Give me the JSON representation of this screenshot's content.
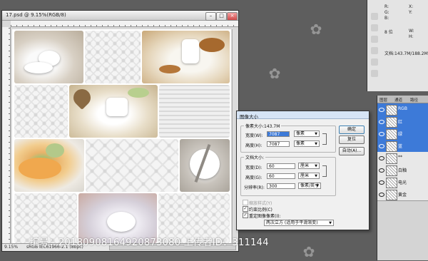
{
  "document": {
    "title": "17.psd @ 9.15%(RGB/8)",
    "zoom": "9.15%",
    "color_profile": "sRGB IEC61966-2.1 (8bpc)"
  },
  "info_panel": {
    "r": "R:",
    "g": "G:",
    "b": "B:",
    "bits": "8 位",
    "x": "X:",
    "y": "Y:",
    "w": "W:",
    "h": "H:",
    "doc": "文档:143.7M/188.2M"
  },
  "layers_panel": {
    "tabs": [
      "图层",
      "通道",
      "路径"
    ],
    "layers": [
      {
        "name": "RGB",
        "selected": true
      },
      {
        "name": "红",
        "selected": true
      },
      {
        "name": "绿",
        "selected": true
      },
      {
        "name": "蓝",
        "selected": true
      },
      {
        "name": "**",
        "selected": false
      },
      {
        "name": "白釉",
        "selected": false
      },
      {
        "name": "电光",
        "selected": false
      },
      {
        "name": "黄金",
        "selected": false
      }
    ]
  },
  "dialog": {
    "title": "图像大小",
    "pixel_dim_label": "像素大小:143.7M",
    "width_label": "宽度(W):",
    "width_value": "7087",
    "width_unit": "像素",
    "height_label": "高度(H):",
    "height_value": "7087",
    "height_unit": "像素",
    "doc_size_label": "文档大小:",
    "doc_width_label": "宽度(D):",
    "doc_width_value": "60",
    "doc_width_unit": "厘米",
    "doc_height_label": "高度(G):",
    "doc_height_value": "60",
    "doc_height_unit": "厘米",
    "resolution_label": "分辨率(R):",
    "resolution_value": "300",
    "resolution_unit": "像素/英寸",
    "scale_styles": "缩放样式(Y)",
    "constrain": "约束比例(C)",
    "resample": "重定图像像素(I):",
    "resample_method": "两次立方 (适用于平滑渐变)",
    "ok": "确定",
    "reset": "复位",
    "auto": "自动(A)..."
  },
  "watermark": {
    "text": "编号：20180908164920873080 上传者ID：311144"
  },
  "colors": {
    "accent": "#3d7ad8",
    "workspace": "#5e5e5e"
  }
}
